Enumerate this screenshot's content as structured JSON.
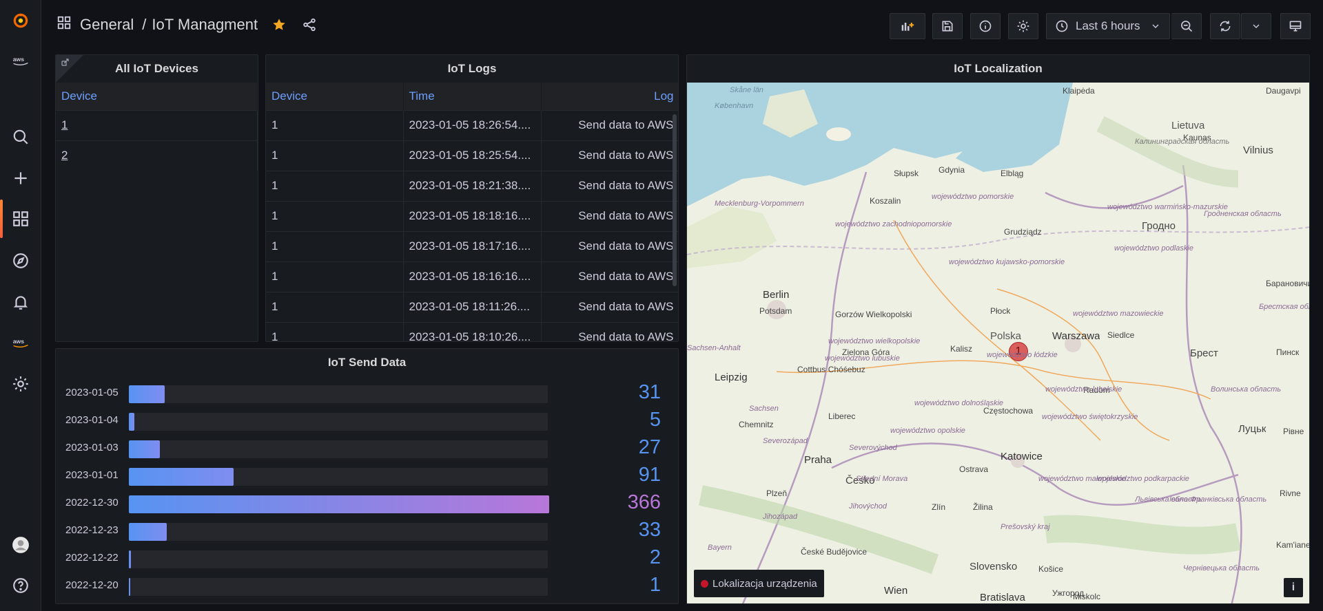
{
  "header": {
    "folder": "General",
    "separator": "/",
    "title": "IoT Managment",
    "time_range": "Last 6 hours"
  },
  "sidebar": {
    "items": [
      "grafana-logo-icon",
      "aws-icon",
      "search-icon",
      "plus-icon",
      "dashboards-icon",
      "explore-icon",
      "alerting-icon",
      "aws-icon",
      "settings-icon",
      "avatar",
      "help-icon"
    ]
  },
  "panels": {
    "devices": {
      "title": "All IoT Devices",
      "column": "Device",
      "rows": [
        "1",
        "2"
      ]
    },
    "logs": {
      "title": "IoT Logs",
      "columns": [
        "Device",
        "Time",
        "Log"
      ],
      "rows": [
        [
          "1",
          "2023-01-05 18:26:54....",
          "Send data to AWS"
        ],
        [
          "1",
          "2023-01-05 18:25:54....",
          "Send data to AWS"
        ],
        [
          "1",
          "2023-01-05 18:21:38....",
          "Send data to AWS"
        ],
        [
          "1",
          "2023-01-05 18:18:16....",
          "Send data to AWS"
        ],
        [
          "1",
          "2023-01-05 18:17:16....",
          "Send data to AWS"
        ],
        [
          "1",
          "2023-01-05 18:16:16....",
          "Send data to AWS"
        ],
        [
          "1",
          "2023-01-05 18:11:26....",
          "Send data to AWS"
        ],
        [
          "1",
          "2023-01-05 18:10:26....",
          "Send data to AWS"
        ]
      ]
    },
    "send_data": {
      "title": "IoT Send Data"
    },
    "map": {
      "title": "IoT Localization",
      "legend": "Lokalizacja urządzenia",
      "marker_label": "1",
      "info": "i",
      "places": [
        "København",
        "Skåne län",
        "Klaipėda",
        "Daugavpi",
        "Lietuva",
        "Kaunas",
        "Vilnius",
        "Калининградская область",
        "Słupsk",
        "Gdynia",
        "Elbląg",
        "Koszalin",
        "województwo pomorskie",
        "Mecklenburg-Vorpommern",
        "województwo zachodniopomorskie",
        "Grudziądz",
        "województwo warmińsko-mazurskie",
        "Гродно",
        "Гродненская область",
        "województwo podlaskie",
        "Berlin",
        "Potsdam",
        "Gorzów Wielkopolski",
        "województwo kujawsko-pomorskie",
        "województwo wielkopolskie",
        "województwo lubuskie",
        "Płock",
        "Polska",
        "Warszawa",
        "Siedlce",
        "Брест",
        "Барановичи",
        "Брестская область",
        "Пинск",
        "Sachsen-Anhalt",
        "Leipzig",
        "Cottbus Chóśebuz",
        "Zielona Góra",
        "Kalisz",
        "województwo łódzkie",
        "województwo mazowieckie",
        "Radom",
        "województwo lubelskie",
        "Волинська область",
        "Луцьк",
        "Рівне",
        "Sachsen",
        "Chemnitz",
        "Liberec",
        "województwo dolnośląskie",
        "Częstochowa",
        "województwo świętokrzyskie",
        "województwo opolskie",
        "Severozápad",
        "Praha",
        "Severovýchod",
        "Katowice",
        "Ostrava",
        "Česko",
        "Plzeň",
        "Jihozápad",
        "Střední Morava",
        "Jihovýchod",
        "Zlín",
        "Žilina",
        "województwo małopolskie",
        "województwo podkarpackie",
        "Львівська область",
        "Bayern",
        "České Budějovice",
        "Prešovský kraj",
        "Slovensko",
        "Košice",
        "Ужгород",
        "Івано-Франківська область",
        "Wien",
        "Bratislava",
        "Miskolc",
        "Чернівецька область",
        "Rivne",
        "Kam'ianets-Podilskyi"
      ]
    }
  },
  "chart_data": {
    "type": "bar",
    "orientation": "horizontal",
    "categories": [
      "2023-01-05",
      "2023-01-04",
      "2023-01-03",
      "2023-01-01",
      "2022-12-30",
      "2022-12-23",
      "2022-12-22",
      "2022-12-20"
    ],
    "values": [
      31,
      5,
      27,
      91,
      366,
      33,
      2,
      1
    ],
    "max": 366,
    "colors": {
      "low": "#5794f2",
      "high": "#b877d9"
    }
  }
}
